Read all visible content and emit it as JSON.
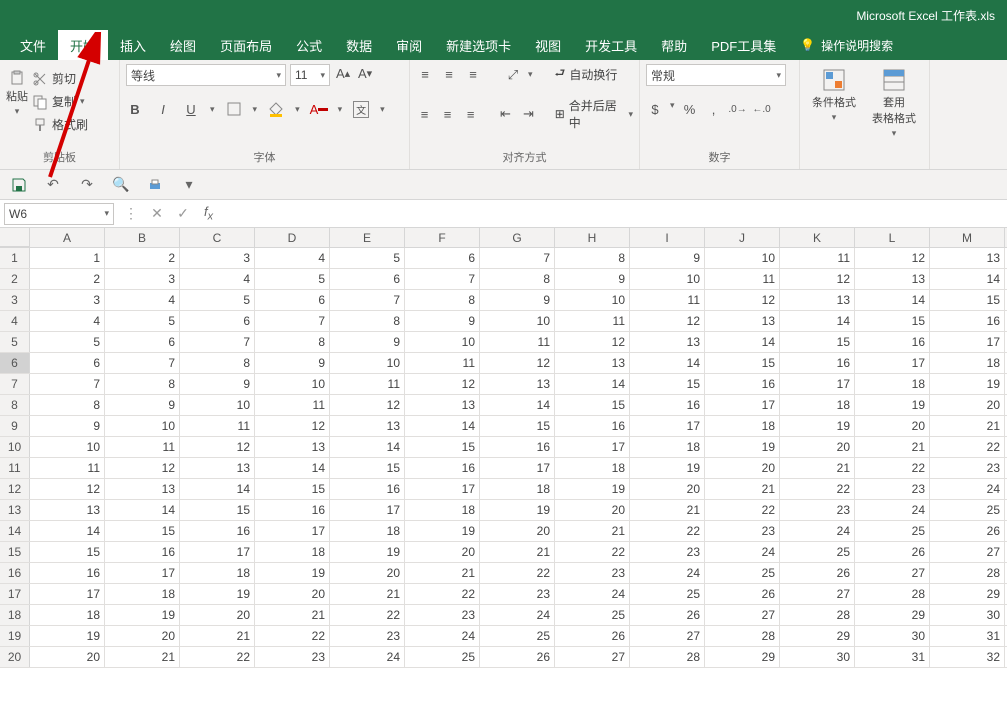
{
  "app_title": "Microsoft Excel 工作表.xls",
  "tabs": [
    "文件",
    "开始",
    "插入",
    "绘图",
    "页面布局",
    "公式",
    "数据",
    "审阅",
    "新建选项卡",
    "视图",
    "开发工具",
    "帮助",
    "PDF工具集"
  ],
  "active_tab_index": 1,
  "tell_me": "操作说明搜索",
  "clipboard": {
    "paste": "粘贴",
    "cut": "剪切",
    "copy": "复制",
    "format_painter": "格式刷",
    "label": "剪贴板"
  },
  "font": {
    "name": "等线",
    "size": "11",
    "label": "字体"
  },
  "align": {
    "wrap": "自动换行",
    "merge": "合并后居中",
    "label": "对齐方式"
  },
  "number": {
    "format": "常规",
    "label": "数字"
  },
  "styles": {
    "cond": "条件格式",
    "table": "套用\n表格格式",
    "label": ""
  },
  "name_box": "W6",
  "columns": [
    "A",
    "B",
    "C",
    "D",
    "E",
    "F",
    "G",
    "H",
    "I",
    "J",
    "K",
    "L",
    "M"
  ],
  "row_count": 20,
  "selected_row": 6
}
